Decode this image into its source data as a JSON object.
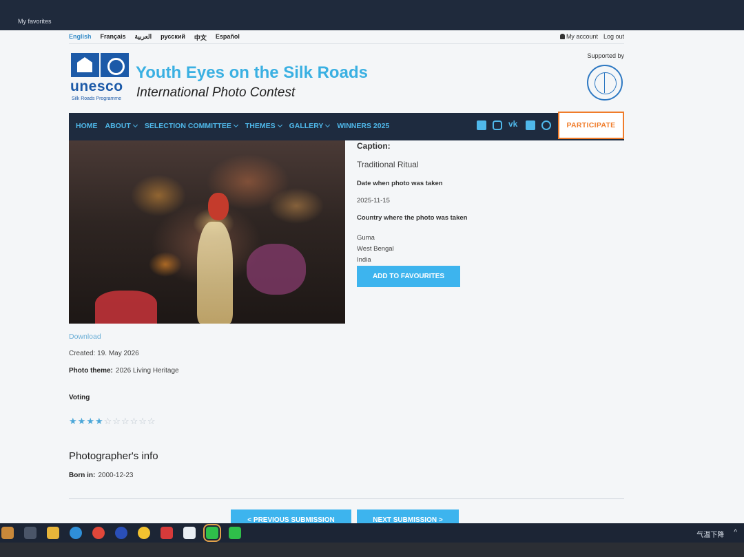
{
  "browser": {
    "favorites_label": "My favorites"
  },
  "languages": [
    "English",
    "Français",
    "العربية",
    "русский",
    "中文",
    "Español"
  ],
  "account": {
    "my_account": "My account",
    "logout": "Log out"
  },
  "header": {
    "logo_word": "unesco",
    "logo_sub": "Silk Roads Programme",
    "title": "Youth Eyes on the Silk Roads",
    "subtitle": "International Photo Contest",
    "supported_by": "Supported by"
  },
  "nav": {
    "items": [
      {
        "label": "HOME",
        "dropdown": false
      },
      {
        "label": "ABOUT",
        "dropdown": true
      },
      {
        "label": "SELECTION COMMITTEE",
        "dropdown": true
      },
      {
        "label": "THEMES",
        "dropdown": true
      },
      {
        "label": "GALLERY",
        "dropdown": true
      },
      {
        "label": "WINNERS 2025",
        "dropdown": false
      }
    ],
    "social_icons": [
      "facebook-icon",
      "instagram-icon",
      "vk-icon",
      "twitter-icon",
      "weibo-icon"
    ],
    "participate": "PARTICIPATE"
  },
  "submission": {
    "caption_label": "Caption:",
    "caption": "Traditional Ritual",
    "date_label": "Date when photo was taken",
    "date": "2025-11-15",
    "country_label": "Country where the photo was taken",
    "location_lines": [
      "Guma",
      "West Bengal",
      "India"
    ],
    "add_favourites": "ADD TO FAVOURITES",
    "download": "Download",
    "created": "Created: 19. May 2026",
    "theme_label": "Photo theme:",
    "theme": "2026 Living Heritage",
    "voting_label": "Voting",
    "rating": {
      "value": 4,
      "max": 10
    },
    "photographer_heading": "Photographer's info",
    "born_label": "Born in:",
    "born": "2000-12-23",
    "prev": "< PREVIOUS SUBMISSION",
    "next": "NEXT SUBMISSION >"
  },
  "taskbar": {
    "weather": "气温下降"
  },
  "colors": {
    "nav_bg": "#1e2b3f",
    "accent": "#3db4ee",
    "participate": "#f07c2a",
    "title_blue": "#3ab0e2"
  }
}
